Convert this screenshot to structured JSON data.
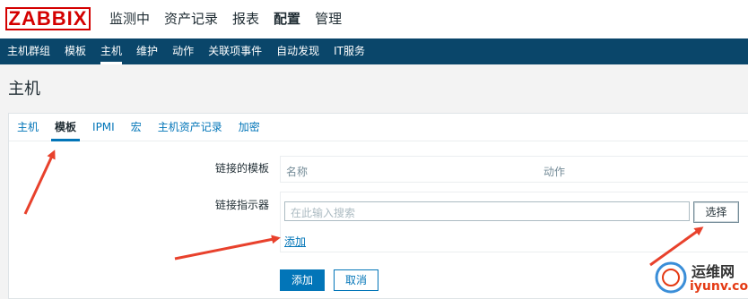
{
  "logo": "ZABBIX",
  "main_menu": [
    "监测中",
    "资产记录",
    "报表",
    "配置",
    "管理"
  ],
  "sub_menu": [
    "主机群组",
    "模板",
    "主机",
    "维护",
    "动作",
    "关联项事件",
    "自动发现",
    "IT服务"
  ],
  "page_title": "主机",
  "tabs": [
    "主机",
    "模板",
    "IPMI",
    "宏",
    "主机资产记录",
    "加密"
  ],
  "form": {
    "linked_templates_label": "链接的模板",
    "col_name": "名称",
    "col_action": "动作",
    "link_indicator_label": "链接指示器",
    "search_placeholder": "在此输入搜索",
    "select_button": "选择",
    "add_link": "添加",
    "add_button": "添加",
    "cancel_button": "取消"
  },
  "watermark": {
    "line1": "运维网",
    "line2": "iyunv.com"
  },
  "colors": {
    "logo_red": "#d40000",
    "nav_blue": "#0a466a",
    "link_blue": "#0275b8",
    "arrow_red": "#e8412c"
  }
}
